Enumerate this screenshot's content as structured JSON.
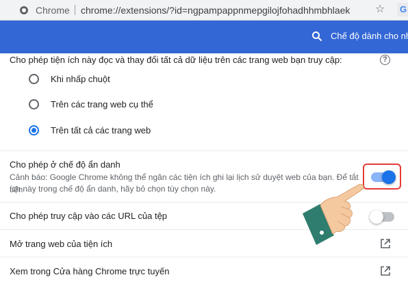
{
  "browser": {
    "site_name": "Chrome",
    "url": "chrome://extensions/?id=ngpampappnmepgilojfohadhhmbhlaek"
  },
  "header": {
    "dev_mode_label": "Chế độ dành cho nhà p"
  },
  "site_access": {
    "heading": "Cho phép tiện ích này đọc và thay đổi tất cả dữ liệu trên các trang web bạn truy cập:",
    "options": [
      {
        "label": "Khi nhấp chuột",
        "checked": false
      },
      {
        "label": "Trên các trang web cụ thể",
        "checked": false
      },
      {
        "label": "Trên tất cả các trang web",
        "checked": true
      }
    ]
  },
  "incognito": {
    "title": "Cho phép ở chế độ ẩn danh",
    "warning_line1": "Cảnh báo: Google Chrome không thể ngăn các tiện ích ghi lại lịch sử duyệt web của bạn. Để tắt tiện",
    "warning_line2": "ích này trong chế độ ẩn danh, hãy bỏ chọn tùy chọn này.",
    "enabled": true
  },
  "file_urls": {
    "title": "Cho phép truy cập vào các URL của tệp",
    "enabled": false
  },
  "links": [
    {
      "label": "Mở trang web của tiện ích"
    },
    {
      "label": "Xem trong Cửa hàng Chrome trực tuyến"
    }
  ],
  "colors": {
    "header_blue": "#3367d6",
    "accent_blue": "#1a73e8",
    "highlight_red": "#e53935",
    "hand_skin": "#f5c9a0",
    "sleeve_teal": "#2e7d6e"
  }
}
